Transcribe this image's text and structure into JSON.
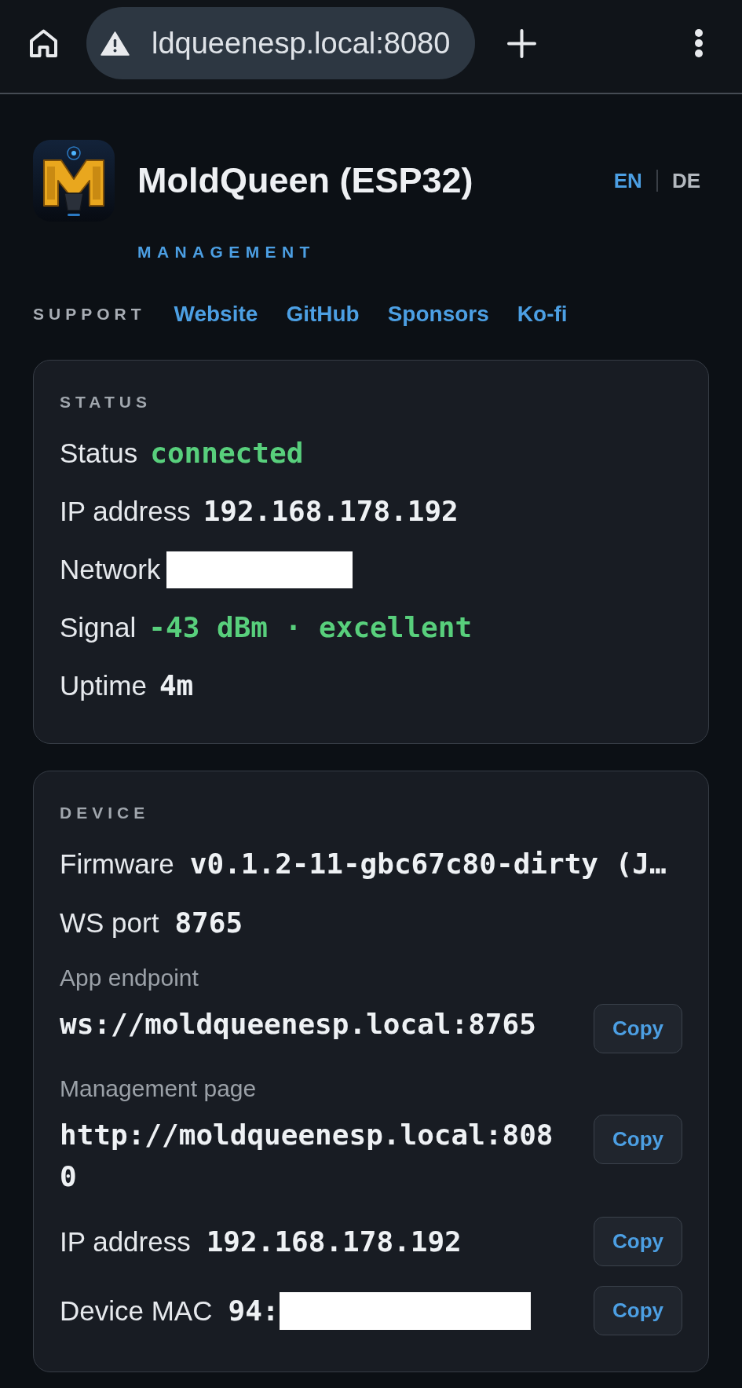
{
  "browser": {
    "url": "ldqueenesp.local:8080",
    "insecure": true
  },
  "header": {
    "title": "MoldQueen (ESP32)",
    "subtitle": "MANAGEMENT",
    "languages": [
      {
        "label": "EN",
        "selected": true
      },
      {
        "label": "DE",
        "selected": false
      }
    ]
  },
  "support": {
    "label": "SUPPORT",
    "links": [
      "Website",
      "GitHub",
      "Sponsors",
      "Ko-fi"
    ]
  },
  "status": {
    "title": "STATUS",
    "rows": [
      {
        "label": "Status",
        "value": "connected",
        "color": "#58cf7c"
      },
      {
        "label": "IP address",
        "value": "192.168.178.192",
        "color": "#eef1f4"
      },
      {
        "label": "Network",
        "redacted": true
      },
      {
        "label": "Signal",
        "value": "-43 dBm · excellent",
        "color": "#58cf7c"
      },
      {
        "label": "Uptime",
        "value": "4m",
        "color": "#eef1f4"
      }
    ]
  },
  "device": {
    "title": "DEVICE",
    "rows": [
      {
        "kind": "inline",
        "label": "Firmware",
        "value": "v0.1.2-11-gbc67c80-dirty (J…"
      },
      {
        "kind": "inline",
        "label": "WS port",
        "value": "8765"
      },
      {
        "kind": "stacked",
        "label": "App endpoint",
        "value": "ws://moldqueenesp.local:8765",
        "button": "Copy"
      },
      {
        "kind": "stacked",
        "label": "Management page",
        "value": "http://moldqueenesp.local:8080",
        "button": "Copy"
      },
      {
        "kind": "inline",
        "label": "IP address",
        "value": "192.168.178.192",
        "button": "Copy"
      },
      {
        "kind": "inline",
        "label": "Device MAC",
        "value": "94:",
        "redacted": true,
        "button": "Copy"
      }
    ]
  }
}
